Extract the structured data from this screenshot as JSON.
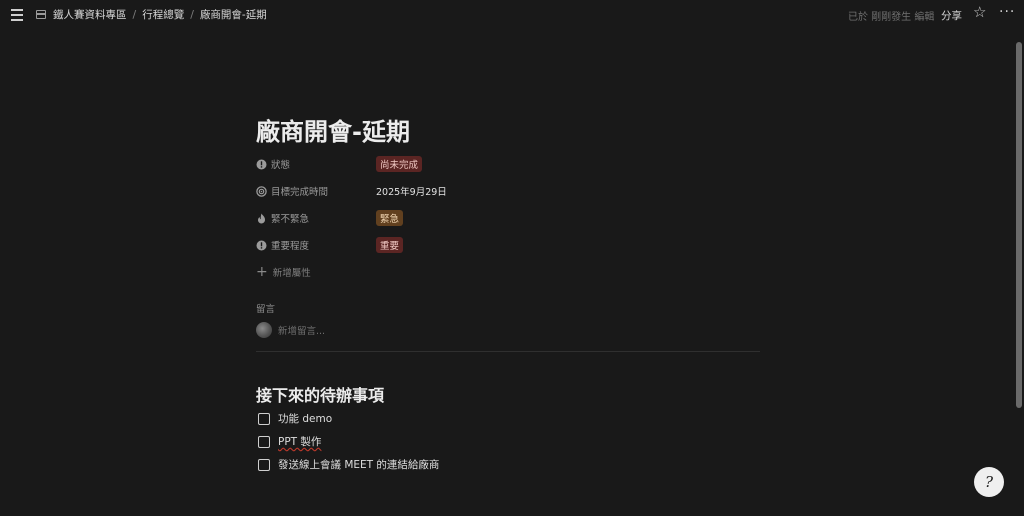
{
  "topbar": {
    "breadcrumbs": [
      "鐵人賽資料專區",
      "行程總覽",
      "廠商開會-延期"
    ],
    "edited": "已於 剛剛發生 編輯",
    "share": "分享"
  },
  "page": {
    "title": "廠商開會-延期",
    "properties": [
      {
        "icon": "status-icon",
        "name": "狀態",
        "value": "尚未完成",
        "tag_color": "#5b2523"
      },
      {
        "icon": "target-icon",
        "name": "目標完成時間",
        "value": "2025年9月29日"
      },
      {
        "icon": "flame-icon",
        "name": "緊不緊急",
        "value": "緊急",
        "tag_color": "#61401f"
      },
      {
        "icon": "alert-icon",
        "name": "重要程度",
        "value": "重要",
        "tag_color": "#5b2523"
      }
    ],
    "add_property": "新增屬性",
    "comments_label": "留言",
    "comment_placeholder": "新增留言...",
    "heading": "接下來的待辦事項",
    "todos": [
      {
        "text": "功能 demo",
        "checked": false
      },
      {
        "text": "PPT 製作",
        "checked": false
      },
      {
        "text": "發送線上會議 MEET 的連結給廠商",
        "checked": false
      }
    ]
  },
  "help_button": "?"
}
